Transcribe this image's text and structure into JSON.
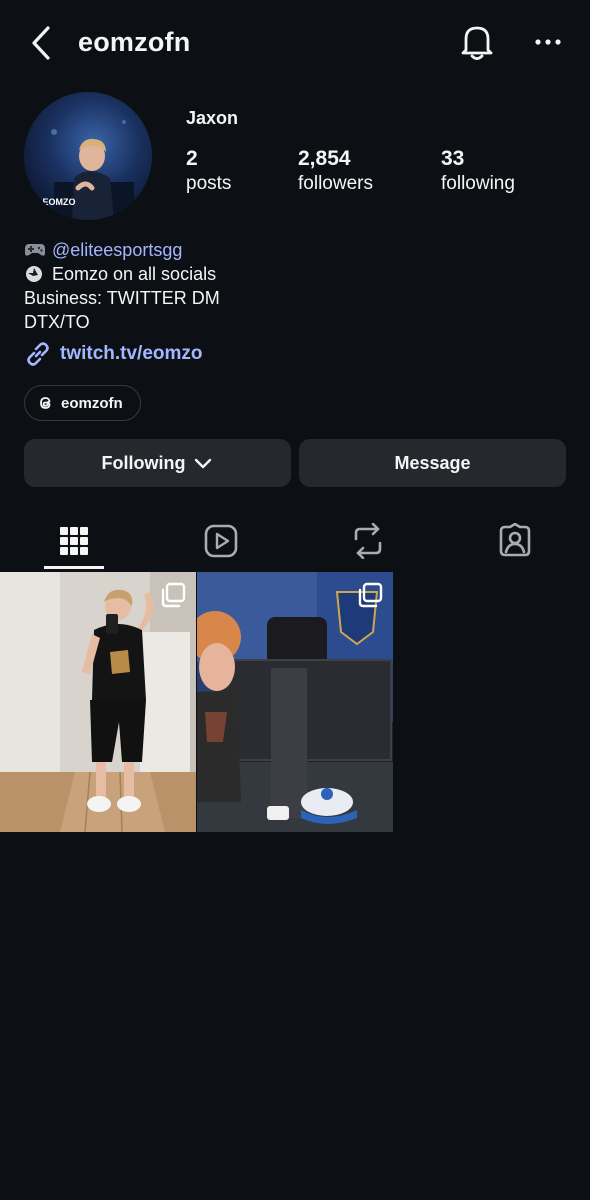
{
  "header": {
    "username": "eomzofn",
    "back_icon": "chevron-left-icon",
    "bell_icon": "bell-icon",
    "more_icon": "more-horizontal-icon"
  },
  "profile": {
    "display_name": "Jaxon",
    "avatar_caption": "E EOMZO",
    "stats": [
      {
        "value": "2",
        "label": "posts"
      },
      {
        "value": "2,854",
        "label": "followers"
      },
      {
        "value": "33",
        "label": "following"
      }
    ]
  },
  "bio": {
    "line1_mention": "@eliteesportsgg",
    "line2": "Eomzo on all socials",
    "line3": "Business: TWITTER DM",
    "line4": "DTX/TO",
    "link": "twitch.tv/eomzo"
  },
  "threads_chip": {
    "label": "eomzofn"
  },
  "actions": {
    "following_label": "Following",
    "message_label": "Message"
  },
  "tabs": [
    {
      "name": "grid",
      "icon": "grid-icon",
      "active": true
    },
    {
      "name": "reels",
      "icon": "reels-icon",
      "active": false
    },
    {
      "name": "reposts",
      "icon": "repost-icon",
      "active": false
    },
    {
      "name": "tagged",
      "icon": "tagged-icon",
      "active": false
    }
  ],
  "posts": [
    {
      "kind": "mirror-selfie",
      "multi": true
    },
    {
      "kind": "esports-event",
      "multi": true
    }
  ],
  "colors": {
    "background": "#0c1014",
    "link": "#a4b6ff",
    "button": "#25292e"
  }
}
